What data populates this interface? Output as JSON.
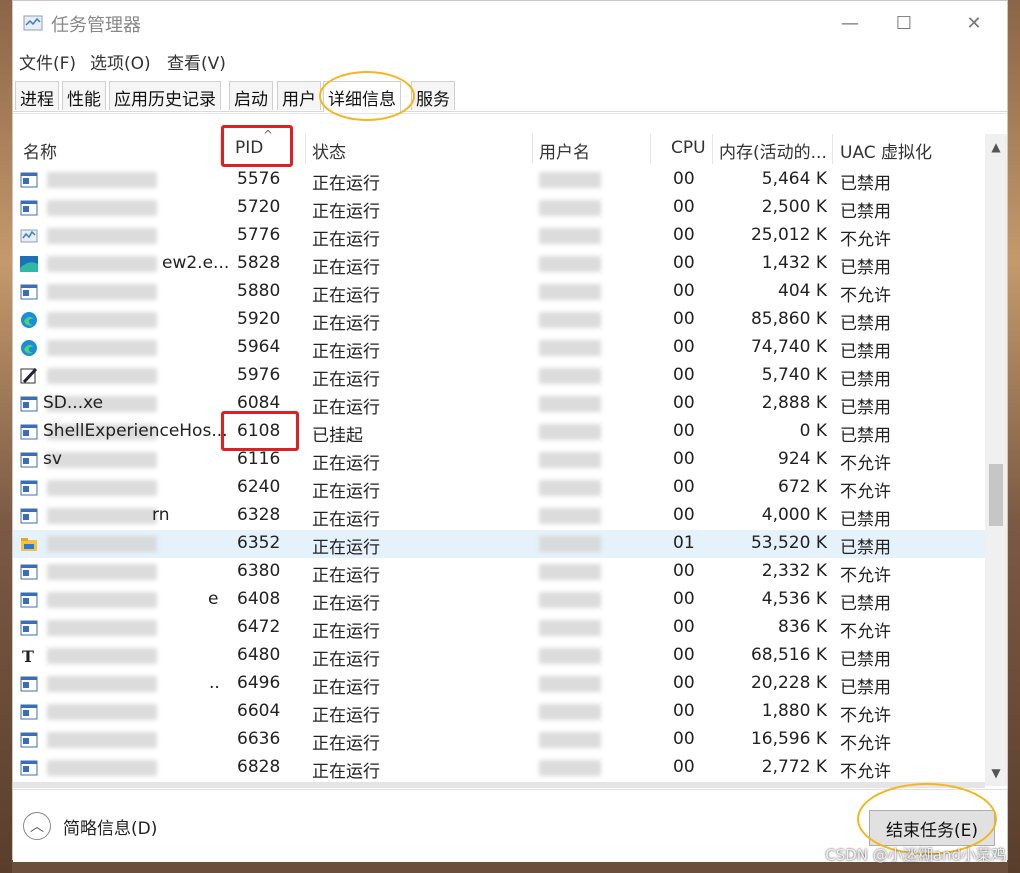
{
  "window": {
    "title": "任务管理器",
    "controls": {
      "minimize": "—",
      "maximize": "☐",
      "close": "✕"
    }
  },
  "menu": [
    "文件(F)",
    "选项(O)",
    "查看(V)"
  ],
  "tabs": [
    "进程",
    "性能",
    "应用历史记录",
    "启动",
    "用户",
    "详细信息",
    "服务"
  ],
  "active_tab": "详细信息",
  "columns": [
    "名称",
    "PID",
    "状态",
    "用户名",
    "CPU",
    "内存(活动的...",
    "UAC 虚拟化"
  ],
  "sort_indicator": "^",
  "rows": [
    {
      "name": "",
      "pid": "5576",
      "status": "正在运行",
      "cpu": "00",
      "mem": "5,464 K",
      "uac": "已禁用",
      "icon": "window-icon"
    },
    {
      "name": "",
      "pid": "5720",
      "status": "正在运行",
      "cpu": "00",
      "mem": "2,500 K",
      "uac": "已禁用",
      "icon": "window-icon"
    },
    {
      "name": "",
      "pid": "5776",
      "status": "正在运行",
      "cpu": "00",
      "mem": "25,012 K",
      "uac": "不允许",
      "icon": "taskmgr-icon"
    },
    {
      "name": "ew2.e...",
      "pid": "5828",
      "status": "正在运行",
      "cpu": "00",
      "mem": "1,432 K",
      "uac": "已禁用",
      "icon": "webview-icon"
    },
    {
      "name": "",
      "pid": "5880",
      "status": "正在运行",
      "cpu": "00",
      "mem": "404 K",
      "uac": "不允许",
      "icon": "window-icon"
    },
    {
      "name": "",
      "pid": "5920",
      "status": "正在运行",
      "cpu": "00",
      "mem": "85,860 K",
      "uac": "已禁用",
      "icon": "edge-icon"
    },
    {
      "name": "",
      "pid": "5964",
      "status": "正在运行",
      "cpu": "00",
      "mem": "74,740 K",
      "uac": "已禁用",
      "icon": "edge-icon"
    },
    {
      "name": "",
      "pid": "5976",
      "status": "正在运行",
      "cpu": "00",
      "mem": "5,740 K",
      "uac": "已禁用",
      "icon": "pen-icon"
    },
    {
      "name": "SD...xe",
      "pid": "6084",
      "status": "正在运行",
      "cpu": "00",
      "mem": "2,888 K",
      "uac": "已禁用",
      "icon": "window-icon"
    },
    {
      "name": "ShellExperienceHos...",
      "pid": "6108",
      "status": "已挂起",
      "cpu": "00",
      "mem": "0 K",
      "uac": "已禁用",
      "icon": "window-icon"
    },
    {
      "name": "sv",
      "pid": "6116",
      "status": "正在运行",
      "cpu": "00",
      "mem": "924 K",
      "uac": "不允许",
      "icon": "window-icon"
    },
    {
      "name": "",
      "pid": "6240",
      "status": "正在运行",
      "cpu": "00",
      "mem": "672 K",
      "uac": "不允许",
      "icon": "window-icon"
    },
    {
      "name": "rn",
      "pid": "6328",
      "status": "正在运行",
      "cpu": "00",
      "mem": "4,000 K",
      "uac": "已禁用",
      "icon": "window-icon"
    },
    {
      "name": "",
      "pid": "6352",
      "status": "正在运行",
      "cpu": "01",
      "mem": "53,520 K",
      "uac": "已禁用",
      "icon": "folder-icon",
      "selected": true
    },
    {
      "name": "",
      "pid": "6380",
      "status": "正在运行",
      "cpu": "00",
      "mem": "2,332 K",
      "uac": "不允许",
      "icon": "window-icon"
    },
    {
      "name": "e",
      "pid": "6408",
      "status": "正在运行",
      "cpu": "00",
      "mem": "4,536 K",
      "uac": "已禁用",
      "icon": "window-icon"
    },
    {
      "name": "",
      "pid": "6472",
      "status": "正在运行",
      "cpu": "00",
      "mem": "836 K",
      "uac": "不允许",
      "icon": "window-icon"
    },
    {
      "name": "",
      "pid": "6480",
      "status": "正在运行",
      "cpu": "00",
      "mem": "68,516 K",
      "uac": "已禁用",
      "icon": "font-icon"
    },
    {
      "name": "..",
      "pid": "6496",
      "status": "正在运行",
      "cpu": "00",
      "mem": "20,228 K",
      "uac": "已禁用",
      "icon": "window-icon"
    },
    {
      "name": "",
      "pid": "6604",
      "status": "正在运行",
      "cpu": "00",
      "mem": "1,880 K",
      "uac": "不允许",
      "icon": "window-icon"
    },
    {
      "name": "",
      "pid": "6636",
      "status": "正在运行",
      "cpu": "00",
      "mem": "16,596 K",
      "uac": "不允许",
      "icon": "window-icon"
    },
    {
      "name": "",
      "pid": "6828",
      "status": "正在运行",
      "cpu": "00",
      "mem": "2,772 K",
      "uac": "不允许",
      "icon": "window-icon"
    }
  ],
  "footer": {
    "fewer_details": "简略信息(D)",
    "end_task": "结束任务(E)"
  },
  "watermark": "CSDN @小迷糊and小菜鸡",
  "colors": {
    "selected_row": "#e5f1fb",
    "highlight_box": "#e02020",
    "circle": "#f3b61f"
  }
}
